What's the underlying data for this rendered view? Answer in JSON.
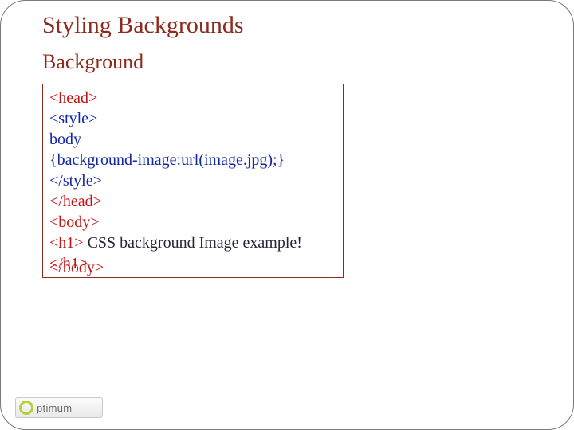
{
  "title": "Styling Backgrounds",
  "subtitle": "Background",
  "code": {
    "l1": "<head>",
    "l2": "<style>",
    "l3": "body",
    "l4": "{background-image:url(image.jpg);}",
    "l5": "</style>",
    "l6": "</head>",
    "l7": "<body>",
    "l8a": "<h1>",
    "l8b": " CSS background Image example!",
    "l9": "</h1>",
    "overflow": "</body>"
  },
  "logo": {
    "text": "ptimum"
  }
}
